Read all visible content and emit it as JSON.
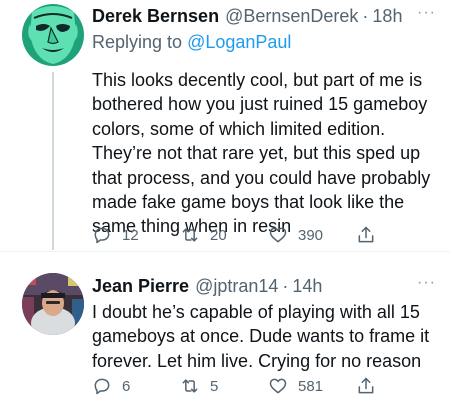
{
  "tweets": [
    {
      "name": "Derek Bernsen",
      "handle": "@BernsenDerek",
      "separator": "·",
      "time": "18h",
      "more": "···",
      "replying_prefix": "Replying to ",
      "replying_to": "@LoganPaul",
      "text": "This looks decently cool, but part of me is\nbothered how you just ruined 15 gameboy\ncolors, some of which limited edition.\nThey’re not that rare yet, but this sped up\nthat process, and you could have probably\nmade fake game boys that look like the\nsame thing when in resin",
      "replies": "12",
      "retweets": "20",
      "likes": "390",
      "avatar_icon": "green-face-avatar"
    },
    {
      "name": "Jean Pierre",
      "handle": "@jptran14",
      "separator": "·",
      "time": "14h",
      "more": "···",
      "text": "I doubt he’s capable of playing with all 15\ngameboys at once. Dude wants to frame it\nforever. Let him live. Crying for no reason",
      "replies": "6",
      "retweets": "5",
      "likes": "581",
      "avatar_icon": "photo-avatar"
    }
  ],
  "colors": {
    "accent": "#1d9bf0",
    "secondary_text": "#536471",
    "primary_text": "#0f1419",
    "thread_line": "#cfd9de"
  }
}
